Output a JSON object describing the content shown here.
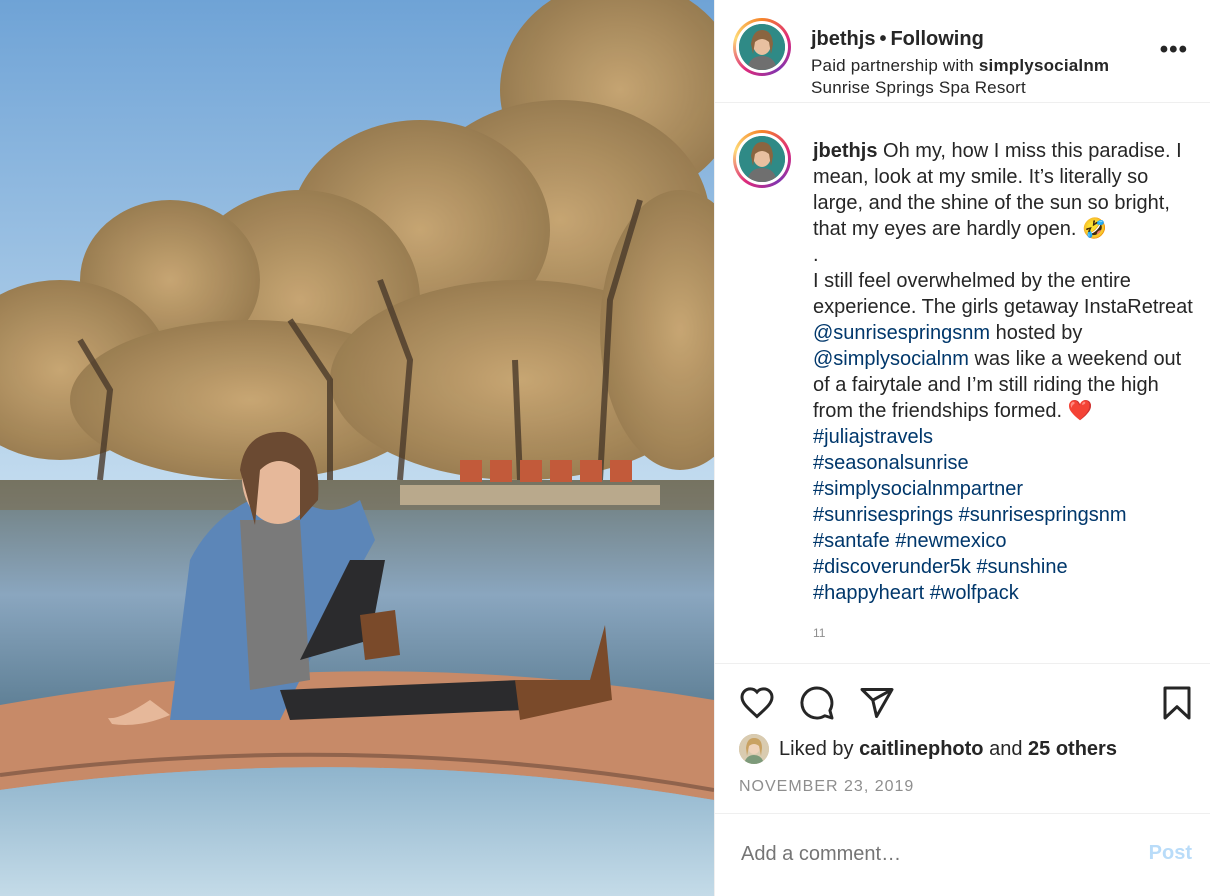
{
  "post_header": {
    "username": "jbethjs",
    "separator": "•",
    "follow_status": "Following",
    "partnership_prefix": "Paid partnership with",
    "partner": "simplysocialnm",
    "location": "Sunrise Springs Spa Resort",
    "more_icon": "more-options-icon"
  },
  "caption": {
    "username": "jbethjs",
    "text_1": "Oh my, how I miss this paradise. I mean, look at my smile. It’s literally so large, and the shine of the sun so bright, that my eyes are hardly open. 🤣",
    "dot": ".",
    "text_2": "I still feel overwhelmed by the entire experience. The girls getaway InstaRetreat",
    "mention_1": "@sunrisespringsnm",
    "text_3": "hosted by",
    "mention_2": "@simplysocialnm",
    "text_4": "was like a weekend out of a fairytale and I’m still riding the high from the friendships formed.",
    "heart": "❤️",
    "hashtags": [
      "#juliajstravels",
      "#seasonalsunrise",
      "#simplysocialnmpartner",
      "#sunrisesprings",
      "#sunrisespringsnm",
      "#santafe",
      "#newmexico",
      "#discoverunder5k",
      "#sunshine",
      "#happyheart",
      "#wolfpack"
    ],
    "overflow_partial": "11"
  },
  "actions": {
    "like_icon": "heart-icon",
    "comment_icon": "comment-icon",
    "share_icon": "share-icon",
    "save_icon": "bookmark-icon"
  },
  "likes": {
    "prefix": "Liked by",
    "user": "caitlinephoto",
    "and": "and",
    "others": "25 others"
  },
  "date": "NOVEMBER 23, 2019",
  "comment_box": {
    "placeholder": "Add a comment…",
    "post_label": "Post"
  },
  "colors": {
    "link": "#00376b",
    "post_button_disabled": "#b9dcf9",
    "muted": "#8e8e8e"
  }
}
